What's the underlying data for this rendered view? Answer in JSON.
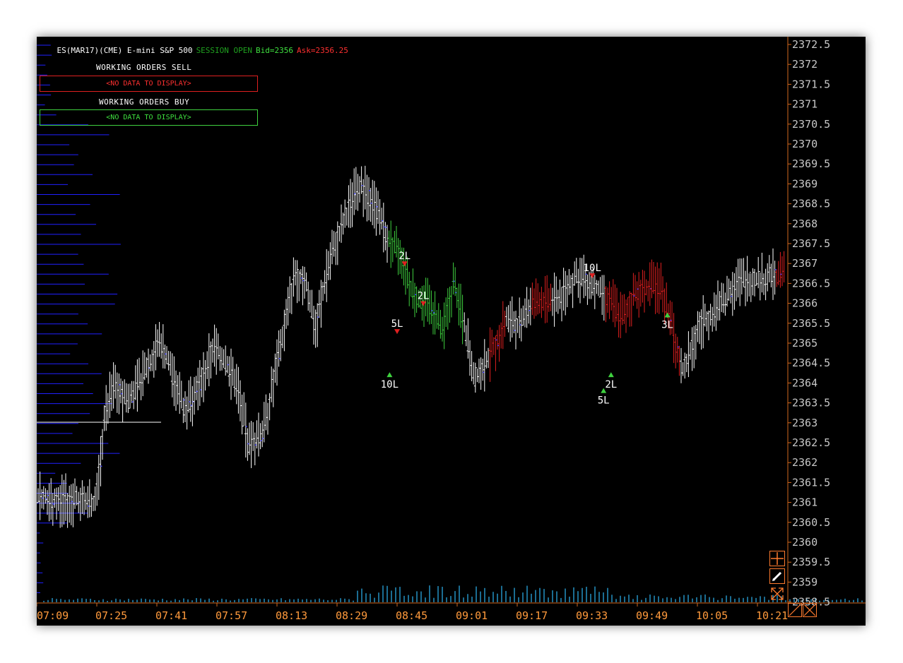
{
  "header": {
    "instrument": "ES(MAR17)(CME) E-mini S&P 500",
    "session": "SESSION OPEN",
    "bid": "Bid=2356",
    "ask": "Ask=2356.25"
  },
  "working_orders": {
    "sell_title": "WORKING ORDERS SELL",
    "sell_message": "<NO DATA TO DISPLAY>",
    "buy_title": "WORKING ORDERS BUY",
    "buy_message": "<NO DATA TO DISPLAY>"
  },
  "colors": {
    "background": "#000000",
    "axis": "#d2691e",
    "price_labels": "#c8c8c8",
    "time_labels": "#ff9a3c",
    "bars_neutral": "#ffffff",
    "bars_up": "#3fd23f",
    "bars_down": "#e02020",
    "volume_profile": "#2020ff",
    "volume": "#2aa8e0",
    "sell_box": "#e02020",
    "buy_box": "#3fd23f"
  },
  "chart_data": {
    "type": "ohlc-bar",
    "price_axis": [
      "2372.5",
      "2372",
      "2371.5",
      "2371",
      "2370.5",
      "2370",
      "2369.5",
      "2369",
      "2368.5",
      "2368",
      "2367.5",
      "2367",
      "2366.5",
      "2366",
      "2365.5",
      "2365",
      "2364.5",
      "2364",
      "2363.5",
      "2363",
      "2362.5",
      "2362",
      "2361.5",
      "2361",
      "2360.5",
      "2360",
      "2359.5",
      "2359",
      "2358.5"
    ],
    "time_axis": [
      "07:09",
      "07:25",
      "07:41",
      "07:57",
      "08:13",
      "08:29",
      "08:45",
      "09:01",
      "09:17",
      "09:33",
      "09:49",
      "10:05",
      "10:21"
    ],
    "price_range": [
      2358.5,
      2372.5
    ],
    "price_path": [
      [
        0,
        2361.2
      ],
      [
        30,
        2361.0
      ],
      [
        60,
        2361.1
      ],
      [
        80,
        2361.0
      ],
      [
        90,
        2361.9
      ],
      [
        95,
        2363.1
      ],
      [
        110,
        2364.0
      ],
      [
        130,
        2363.5
      ],
      [
        155,
        2364.3
      ],
      [
        175,
        2365.1
      ],
      [
        190,
        2364.3
      ],
      [
        210,
        2363.3
      ],
      [
        230,
        2363.9
      ],
      [
        250,
        2364.9
      ],
      [
        265,
        2364.6
      ],
      [
        285,
        2363.9
      ],
      [
        300,
        2362.4
      ],
      [
        320,
        2362.7
      ],
      [
        335,
        2364.0
      ],
      [
        350,
        2365.3
      ],
      [
        365,
        2366.7
      ],
      [
        380,
        2366.6
      ],
      [
        395,
        2365.4
      ],
      [
        410,
        2366.7
      ],
      [
        425,
        2367.6
      ],
      [
        440,
        2368.3
      ],
      [
        455,
        2369.0
      ],
      [
        470,
        2368.7
      ],
      [
        485,
        2368.2
      ],
      [
        500,
        2367.5
      ],
      [
        515,
        2367.3
      ],
      [
        530,
        2366.4
      ],
      [
        545,
        2366.0
      ],
      [
        560,
        2365.9
      ],
      [
        575,
        2365.2
      ],
      [
        590,
        2366.5
      ],
      [
        605,
        2365.5
      ],
      [
        620,
        2364.1
      ],
      [
        635,
        2364.5
      ],
      [
        650,
        2365.0
      ],
      [
        665,
        2365.6
      ],
      [
        680,
        2365.4
      ],
      [
        695,
        2365.8
      ],
      [
        710,
        2366.1
      ],
      [
        725,
        2366.0
      ],
      [
        745,
        2366.2
      ],
      [
        765,
        2366.7
      ],
      [
        785,
        2366.5
      ],
      [
        800,
        2366.3
      ],
      [
        815,
        2366.0
      ],
      [
        830,
        2365.6
      ],
      [
        845,
        2366.2
      ],
      [
        860,
        2366.4
      ],
      [
        885,
        2366.4
      ],
      [
        900,
        2365.3
      ],
      [
        915,
        2364.3
      ],
      [
        940,
        2365.5
      ],
      [
        960,
        2365.8
      ],
      [
        975,
        2366.1
      ],
      [
        990,
        2366.5
      ],
      [
        1005,
        2366.6
      ],
      [
        1030,
        2366.6
      ],
      [
        1037,
        2366.7
      ]
    ],
    "volume_profile_levels": [
      2372.5,
      2371.5
    ],
    "trade_markers": [
      {
        "label": "2L",
        "price": 2367.0,
        "time": "08:47"
      },
      {
        "label": "5L",
        "price": 2365.3,
        "time": "08:45"
      },
      {
        "label": "10L",
        "price": 2364.2,
        "time": "08:43"
      },
      {
        "label": "2L",
        "price": 2366.0,
        "time": "08:52"
      },
      {
        "label": "10L",
        "price": 2366.7,
        "time": "09:37"
      },
      {
        "label": "2L",
        "price": 2364.2,
        "time": "09:42"
      },
      {
        "label": "5L",
        "price": 2363.8,
        "time": "09:40"
      },
      {
        "label": "3L",
        "price": 2365.7,
        "time": "09:57"
      }
    ]
  }
}
